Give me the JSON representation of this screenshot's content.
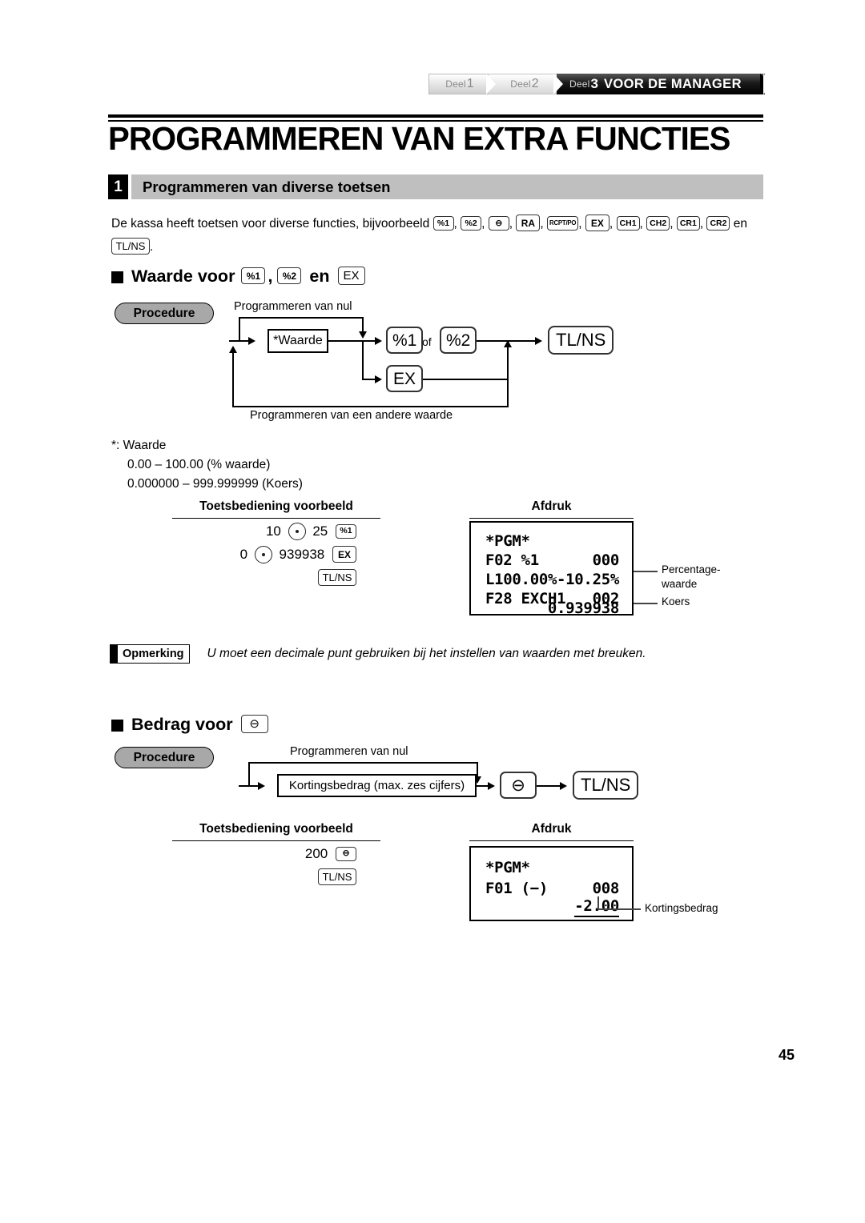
{
  "header": {
    "tabs": [
      {
        "word": "Deel",
        "num": "1"
      },
      {
        "word": "Deel",
        "num": "2"
      },
      {
        "word": "Deel",
        "num": "3"
      }
    ],
    "active_label": "VOOR DE MANAGER"
  },
  "page_title": "PROGRAMMEREN VAN EXTRA FUNCTIES",
  "section": {
    "number": "1",
    "title": "Programmeren van diverse toetsen"
  },
  "intro": {
    "text_before": "De kassa heeft toetsen voor diverse functies, bijvoorbeeld",
    "keys": [
      "%1",
      "%2",
      "⊖",
      "RA",
      "RCPT/PO",
      "EX",
      "CH1",
      "CH2",
      "CR1",
      "CR2"
    ],
    "conjunction": "en",
    "last_key": "TL/NS",
    "period": "."
  },
  "sub1": {
    "heading_prefix": "Waarde voor",
    "heading_key1": "%1",
    "heading_comma": ",",
    "heading_key2": "%2",
    "heading_en": "en",
    "heading_key3": "EX",
    "procedure_label": "Procedure",
    "flow": {
      "top_label": "Programmeren van nul",
      "bottom_label": "Programmeren van een andere waarde",
      "box_value": "*Waarde",
      "key_pct1": "%1",
      "of": "of",
      "key_pct2": "%2",
      "key_ex": "EX",
      "key_tlns": "TL/NS"
    },
    "values": {
      "star_label": "*:  Waarde",
      "range_pct": "0.00 – 100.00 (% waarde)",
      "range_rate": "0.000000 – 999.999999 (Koers)"
    },
    "col_head_left": "Toetsbediening voorbeeld",
    "col_head_right": "Afdruk",
    "keyops": [
      {
        "num1": "10",
        "num2": "25",
        "key": "%1"
      },
      {
        "num1": "0",
        "num2": "939938",
        "key": "EX"
      }
    ],
    "keyops_final": "TL/NS",
    "receipt": {
      "title": "*PGM*",
      "rows": [
        {
          "left": "F02 %1",
          "right": "000"
        },
        {
          "left": "L100.00%",
          "right": "-10.25%"
        },
        {
          "left": "F28 EXCH1",
          "right": "002"
        },
        {
          "left": "",
          "right": "0.939938"
        }
      ]
    },
    "callouts": [
      {
        "text_line1": "Percentage-",
        "text_line2": "waarde"
      },
      {
        "text_line1": "Koers",
        "text_line2": ""
      }
    ]
  },
  "note": {
    "badge": "Opmerking",
    "text": "U moet een decimale punt gebruiken bij het instellen van waarden met breuken."
  },
  "sub2": {
    "heading_prefix": "Bedrag voor",
    "heading_key": "⊖",
    "procedure_label": "Procedure",
    "flow": {
      "top_label": "Programmeren van nul",
      "box_value": "Kortingsbedrag (max. zes cijfers)",
      "key_minus": "⊖",
      "key_tlns": "TL/NS"
    },
    "col_head_left": "Toetsbediening voorbeeld",
    "col_head_right": "Afdruk",
    "keyops": [
      {
        "num": "200",
        "key": "⊖"
      }
    ],
    "keyops_final": "TL/NS",
    "receipt": {
      "title": "*PGM*",
      "rows": [
        {
          "left": "F01 (−)",
          "right": "008"
        },
        {
          "left": "",
          "right": "-2.00"
        }
      ]
    },
    "callout": {
      "text": "Kortingsbedrag"
    }
  },
  "page_number": "45",
  "colors": {
    "section_band": "#bfbfbf",
    "procedure_pill": "#a8a8a8",
    "active_tab": "#000000"
  }
}
